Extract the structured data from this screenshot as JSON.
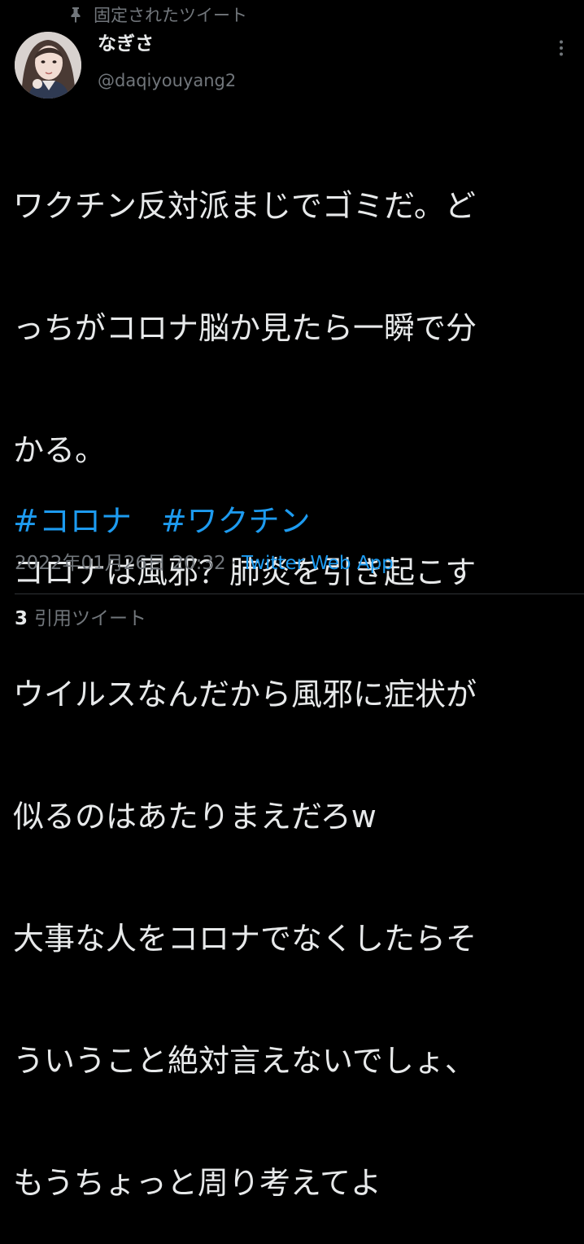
{
  "pinned": {
    "label": "固定されたツイート",
    "icon": "pin-icon"
  },
  "author": {
    "display_name": "なぎさ",
    "handle": "@daqiyouyang2"
  },
  "tweet": {
    "lines": [
      "ワクチン反対派まじでゴミだ。ど",
      "っちがコロナ脳か見たら一瞬で分",
      "かる。",
      "コロナは風邪？肺炎を引き起こす",
      "ウイルスなんだから風邪に症状が",
      "似るのはあたりまえだろw",
      "大事な人をコロナでなくしたらそ",
      "ういうこと絶対言えないでしょ、",
      "もうちょっと周り考えてよ"
    ],
    "hashtags": [
      "#コロナ",
      "#ワクチン"
    ]
  },
  "meta": {
    "timestamp": "2022年01月26日 20:32",
    "separator": "·",
    "source": "Twitter Web App"
  },
  "stats": {
    "quote_count": "3",
    "quote_label": "引用ツイート"
  },
  "colors": {
    "background": "#000000",
    "text": "#e7e9ea",
    "secondary": "#71767b",
    "accent": "#1d9bf0",
    "divider": "#2f3336"
  }
}
